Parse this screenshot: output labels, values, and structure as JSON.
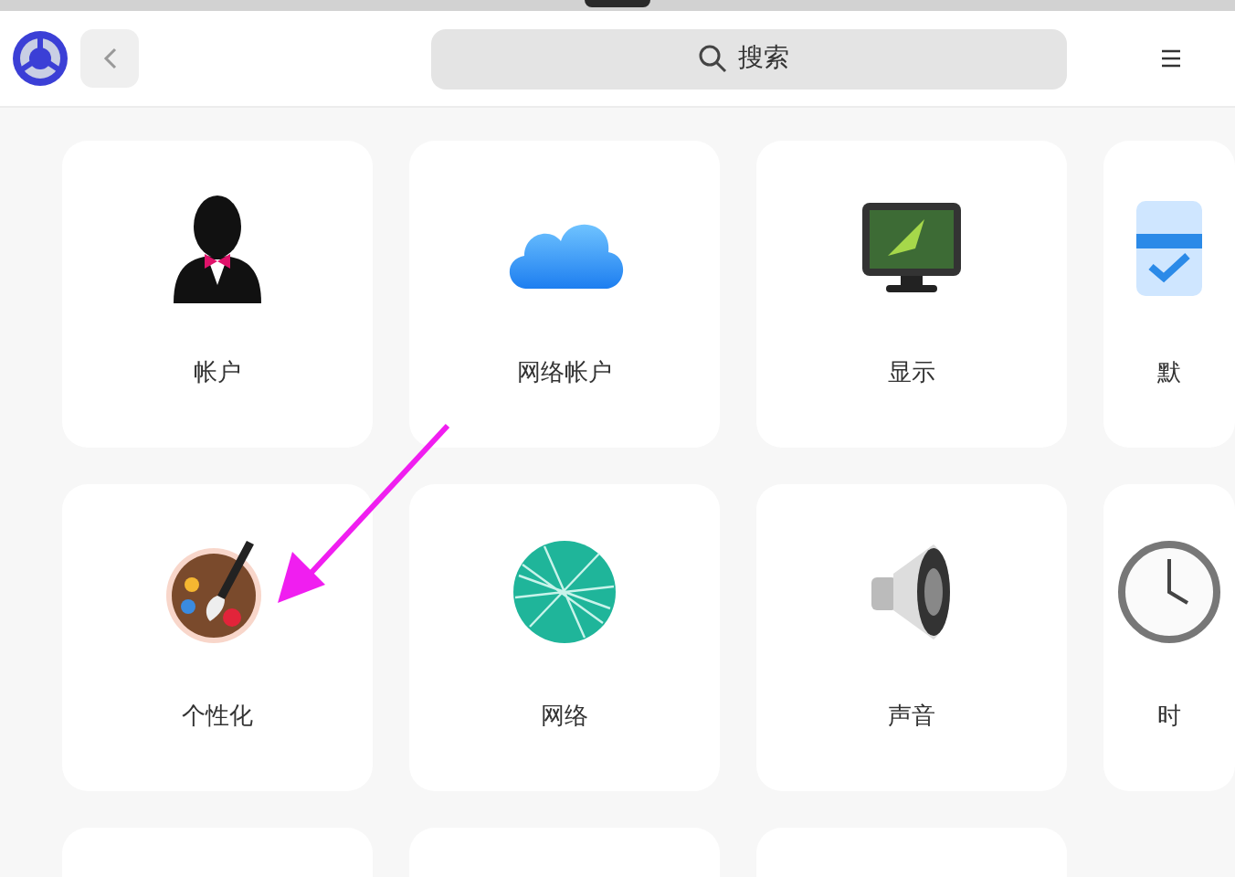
{
  "header": {
    "search": {
      "placeholder": "搜索"
    }
  },
  "modules": [
    {
      "kind": "account",
      "label": "帐户"
    },
    {
      "kind": "cloud",
      "label": "网络帐户"
    },
    {
      "kind": "display",
      "label": "显示"
    },
    {
      "kind": "defaults",
      "label": "默"
    },
    {
      "kind": "personal",
      "label": "个性化"
    },
    {
      "kind": "network",
      "label": "网络"
    },
    {
      "kind": "sound",
      "label": "声音"
    },
    {
      "kind": "clock",
      "label": "时"
    },
    {
      "kind": "blank"
    },
    {
      "kind": "blank"
    },
    {
      "kind": "blank"
    }
  ]
}
